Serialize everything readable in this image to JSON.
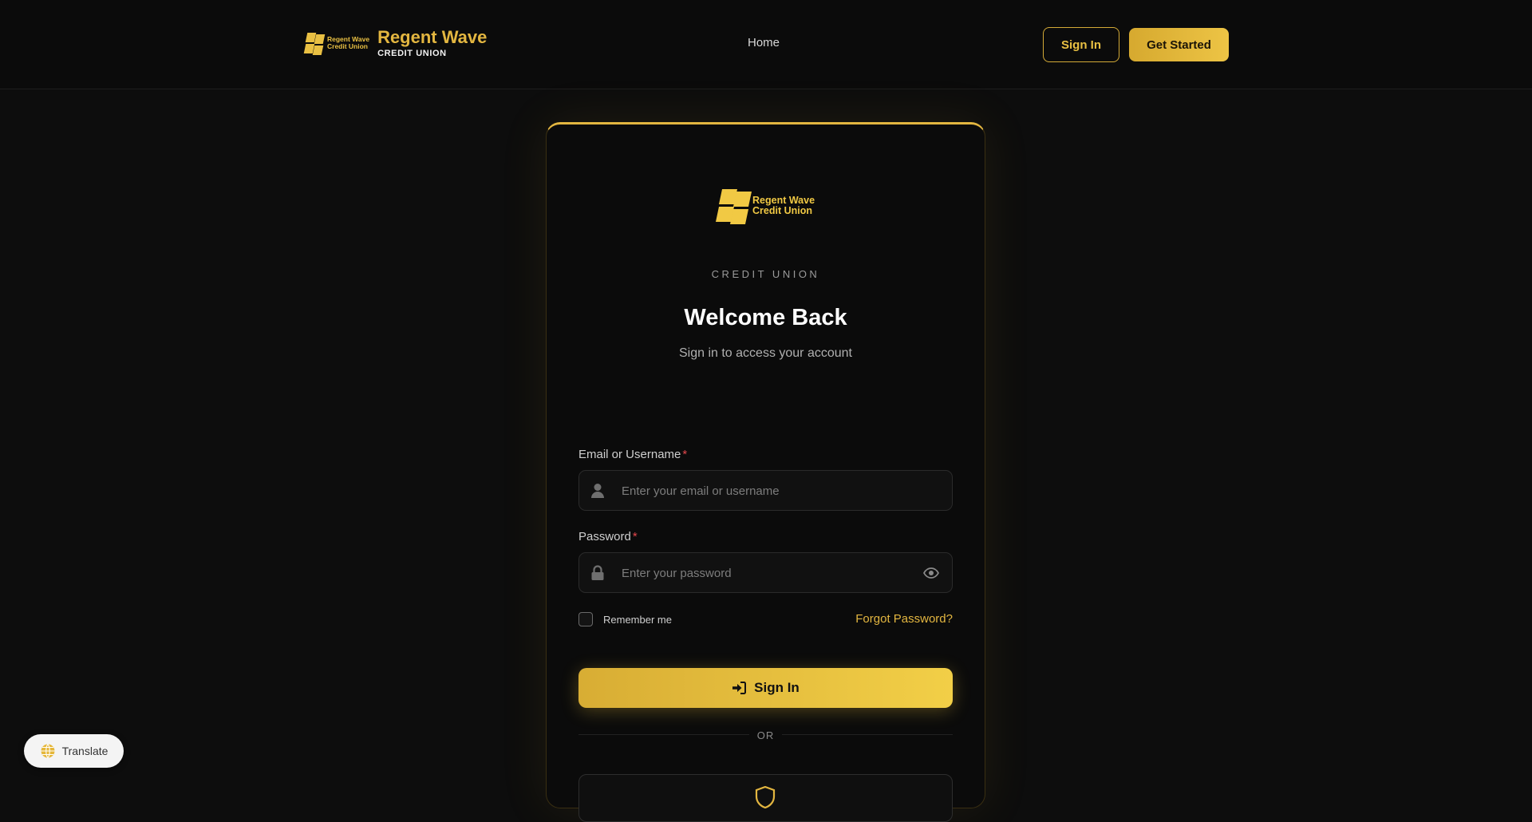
{
  "header": {
    "logo_line1": "Regent Wave",
    "logo_line2": "Credit Union",
    "brand_name": "Regent Wave",
    "brand_sub": "CREDIT UNION",
    "nav_home": "Home",
    "signin_label": "Sign In",
    "get_started_label": "Get Started"
  },
  "card": {
    "logo_line1": "Regent Wave",
    "logo_line2": "Credit Union",
    "eyebrow": "CREDIT UNION",
    "title": "Welcome Back",
    "subtitle": "Sign in to access your account"
  },
  "form": {
    "email_label": "Email or Username",
    "email_placeholder": "Enter your email or username",
    "email_value": "",
    "password_label": "Password",
    "password_placeholder": "Enter your password",
    "password_value": "",
    "required_mark": "*",
    "remember_label": "Remember me",
    "remember_checked": false,
    "forgot_label": "Forgot Password?",
    "submit_label": "Sign In",
    "or_label": "OR"
  },
  "translate": {
    "label": "Translate"
  },
  "icons": {
    "logo": "brand-mark-icon",
    "email": "user-icon",
    "password": "lock-icon",
    "toggle": "eye-icon",
    "submit": "sign-in-icon",
    "alt": "shield-icon",
    "translate": "globe-icon"
  },
  "colors": {
    "accent": "#e3b640",
    "background": "#0d0d0d",
    "card": "#0b0b0b",
    "required": "#e5484d"
  }
}
